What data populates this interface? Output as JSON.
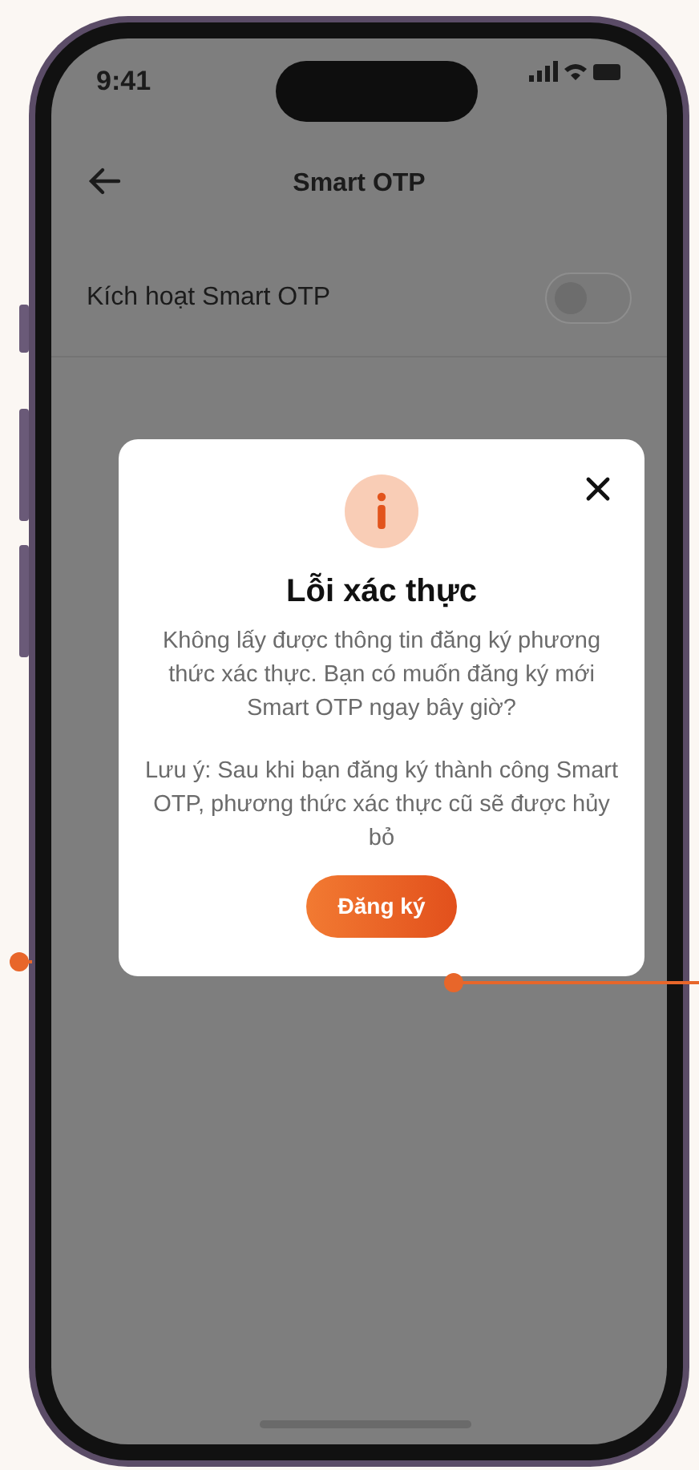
{
  "status_bar": {
    "time": "9:41"
  },
  "header": {
    "title": "Smart OTP"
  },
  "settings": [
    {
      "label": "Kích hoạt Smart OTP",
      "on": false
    }
  ],
  "dialog": {
    "title": "Lỗi xác thực",
    "message": "Không lấy được thông tin đăng ký phương thức xác thực. Bạn có muốn đăng ký mới Smart OTP ngay bây giờ?",
    "note": "Lưu ý: Sau khi bạn đăng ký thành công Smart OTP, phương thức xác thực cũ sẽ được hủy bỏ",
    "button": "Đăng ký"
  }
}
